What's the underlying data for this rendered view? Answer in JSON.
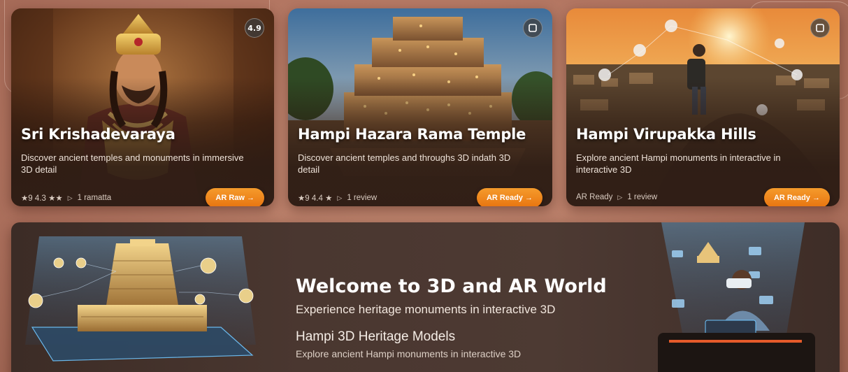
{
  "cards": [
    {
      "title": "Sri Krishadevaraya",
      "description": "Discover ancient temples and monuments in immersive 3D detail",
      "rating_text": "★9 4.3 ★★",
      "reviews_text": "1 ramatta",
      "badge_text": "4.9",
      "button_label": "AR Raw →",
      "icon": "person-portrait"
    },
    {
      "title": "Hampi Hazara Rama Temple",
      "description": "Discover ancient temples and throughs 3D indath 3D detail",
      "rating_text": "★9 4.4 ★",
      "reviews_text": "1 review",
      "badge_icon": "cube-icon",
      "button_label": "AR Ready →",
      "icon": "temple"
    },
    {
      "title": "Hampi Virupakka Hills",
      "description": "Explore ancient Hampi monuments in interactive in interactive 3D",
      "rating_text": "AR Ready",
      "reviews_text": "1 review",
      "badge_icon": "cube-icon",
      "button_label": "AR Ready →",
      "icon": "hill-landscape"
    }
  ],
  "banner": {
    "title": "Welcome to 3D and AR World",
    "subtitle": "Experience heritage monuments in interactive 3D",
    "section_title": "Hampi 3D Heritage Models",
    "section_desc": "Explore ancient Hampi monuments in interactive 3D"
  },
  "colors": {
    "accent": "#f08a1e",
    "background": "#b87a65",
    "panel": "#45332c"
  }
}
